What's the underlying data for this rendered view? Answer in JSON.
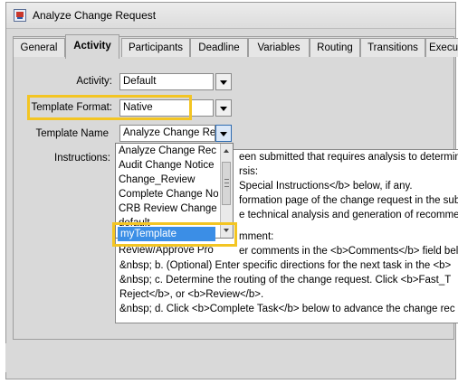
{
  "window": {
    "title": "Analyze Change Request"
  },
  "tabs": [
    "General",
    "Activity",
    "Participants",
    "Deadline",
    "Variables",
    "Routing",
    "Transitions",
    "Execu"
  ],
  "form": {
    "activity_label": "Activity:",
    "activity_value": "Default",
    "template_format_label": "Template Format:",
    "template_format_value": "Native",
    "template_name_label": "Template Name",
    "template_name_value": "Analyze Change Re",
    "instructions_label": "Instructions:"
  },
  "dropdown": {
    "items": [
      "Analyze Change Rec",
      "Audit Change Notice",
      "Change_Review",
      "Complete Change No",
      "CRB Review Change",
      "default"
    ],
    "selected": "myTemplate",
    "partial_below": "Review/Approve Pro"
  },
  "instructions": {
    "lines": [
      "een submitted that requires analysis to determin",
      "rsis:",
      "Special Instructions</b> below, if any.",
      "formation page of the change request in the sub",
      "e technical analysis and generation of recommen",
      "",
      "mment:",
      "er comments in the <b>Comments</b> field below",
      "&nbsp; b. (Optional) Enter specific directions for the next task in the <b>",
      "&nbsp; c. Determine the routing of the change request.  Click <b>Fast_T",
      "Reject</b>, or <b>Review</b>.",
      "&nbsp; d. Click <b>Complete Task</b> below to advance the change rec"
    ]
  },
  "colors": {
    "highlight": "#f3c523",
    "selection": "#3b8ee6"
  }
}
